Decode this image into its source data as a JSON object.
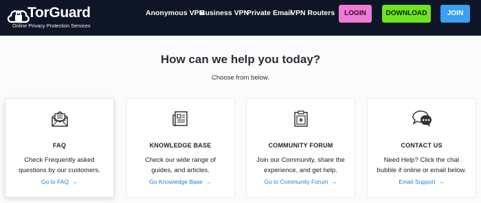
{
  "header": {
    "logo_text": "TorGuard",
    "logo_tagline": "Online Privacy Protection Services",
    "nav": [
      "Anonymous VPN",
      "Business VPN",
      "Private Email",
      "VPN Routers"
    ],
    "login_label": "LOGIN",
    "download_label": "DOWNLOAD",
    "join_label": "JOIN"
  },
  "main": {
    "heading": "How can we help you today?",
    "subheading": "Choose from below."
  },
  "cards": [
    {
      "icon": "envelope-icon",
      "title": "FAQ",
      "desc1": "Check Frequently asked",
      "desc2": "questions by our customers.",
      "link": "Go to FAQ"
    },
    {
      "icon": "newspaper-icon",
      "title": "KNOWLEDGE BASE",
      "desc1": "Check our wide range of",
      "desc2": "guides, and articles.",
      "link": "Go Knowledge Base"
    },
    {
      "icon": "clipboard-plus-icon",
      "title": "COMMUNITY FORUM",
      "desc1": "Join our Community, share the",
      "desc2": "experience, and get help.",
      "link": "Go to Community Forum"
    },
    {
      "icon": "chat-bubbles-icon",
      "title": "CONTACT US",
      "desc1": "Need Help? Click the chat",
      "desc2": "bubble if online or email below.",
      "link": "Email Support"
    }
  ],
  "colors": {
    "topbar": "#0d1526",
    "login": "#f07bd6",
    "download": "#6ee420",
    "join": "#3aa0f0",
    "link": "#1e7fd8"
  }
}
